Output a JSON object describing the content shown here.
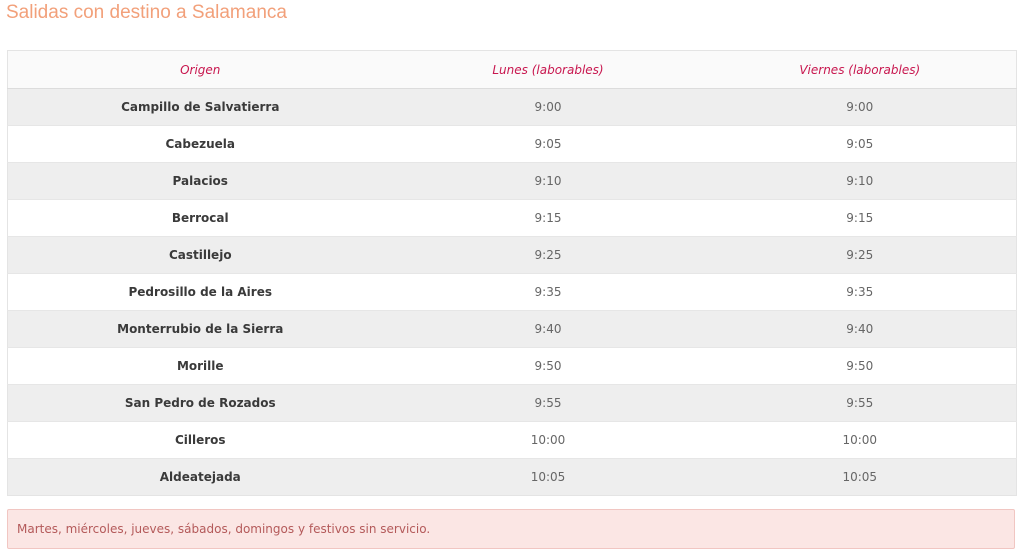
{
  "page": {
    "title": "Salidas con destino a Salamanca"
  },
  "table": {
    "headers": [
      "Origen",
      "Lunes (laborables)",
      "Viernes (laborables)"
    ],
    "rows": [
      {
        "origin": "Campillo de Salvatierra",
        "monday": "9:00",
        "friday": "9:00"
      },
      {
        "origin": "Cabezuela",
        "monday": "9:05",
        "friday": "9:05"
      },
      {
        "origin": "Palacios",
        "monday": "9:10",
        "friday": "9:10"
      },
      {
        "origin": "Berrocal",
        "monday": "9:15",
        "friday": "9:15"
      },
      {
        "origin": "Castillejo",
        "monday": "9:25",
        "friday": "9:25"
      },
      {
        "origin": "Pedrosillo de la Aires",
        "monday": "9:35",
        "friday": "9:35"
      },
      {
        "origin": "Monterrubio de la Sierra",
        "monday": "9:40",
        "friday": "9:40"
      },
      {
        "origin": "Morille",
        "monday": "9:50",
        "friday": "9:50"
      },
      {
        "origin": "San Pedro de Rozados",
        "monday": "9:55",
        "friday": "9:55"
      },
      {
        "origin": "Cilleros",
        "monday": "10:00",
        "friday": "10:00"
      },
      {
        "origin": "Aldeatejada",
        "monday": "10:05",
        "friday": "10:05"
      }
    ]
  },
  "notice": {
    "text": "Martes, miércoles, jueves, sábados, domingos y festivos sin servicio."
  },
  "colors": {
    "title": "#f2a07a",
    "header_text": "#c8174f",
    "row_stripe": "#eeeeee",
    "notice_bg": "#fbe6e4",
    "notice_text": "#b45a5a"
  }
}
